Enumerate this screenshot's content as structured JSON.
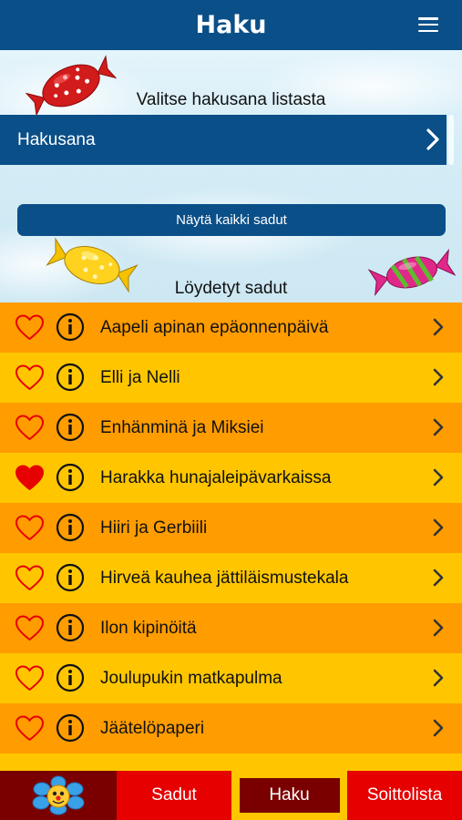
{
  "header": {
    "title": "Haku",
    "menu_icon": "hamburger-menu-icon"
  },
  "search": {
    "prompt": "Valitse hakusana listasta",
    "field_label": "Hakusana",
    "show_all_label": "Näytä kaikki sadut",
    "found_label": "Löydetyt sadut"
  },
  "stories": [
    {
      "title": "Aapeli apinan epäonnenpäivä",
      "favorite": false
    },
    {
      "title": "Elli ja Nelli",
      "favorite": false
    },
    {
      "title": "Enhänminä ja Miksiei",
      "favorite": false
    },
    {
      "title": "Harakka hunajaleipävarkaissa",
      "favorite": true
    },
    {
      "title": "Hiiri ja Gerbiili",
      "favorite": false
    },
    {
      "title": "Hirveä kauhea jättiläismustekala",
      "favorite": false
    },
    {
      "title": "Ilon kipinöitä",
      "favorite": false
    },
    {
      "title": "Joulupukin matkapulma",
      "favorite": false
    },
    {
      "title": "Jäätelöpaperi",
      "favorite": false
    }
  ],
  "tabs": {
    "home_icon": "flower-mascot-icon",
    "sadut": "Sadut",
    "haku": "Haku",
    "soittolista": "Soittolista"
  },
  "colors": {
    "primary_blue": "#0a4f88",
    "row_orange": "#ff9c00",
    "row_yellow": "#ffc600",
    "tab_red": "#e60000",
    "tab_dark_red": "#7a0000",
    "heart_red": "#e60000"
  }
}
